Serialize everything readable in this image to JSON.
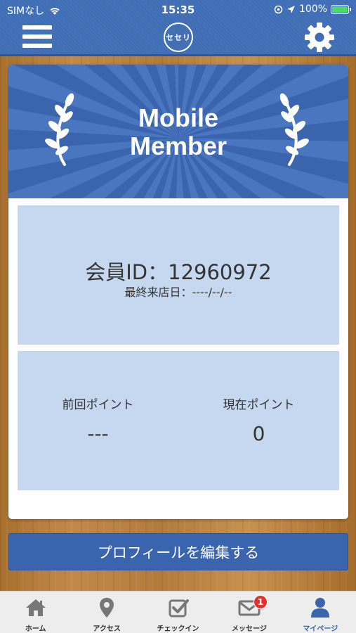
{
  "status_bar": {
    "carrier": "SIMなし",
    "time": "15:35",
    "battery": "100%"
  },
  "header": {
    "logo_text": "セセリ",
    "menu_icon": "hamburger-icon",
    "settings_icon": "gear-icon"
  },
  "banner": {
    "line1": "Mobile",
    "line2": "Member"
  },
  "member": {
    "id_text": "会員ID：12960972",
    "last_visit": "最終来店日：----/--/--"
  },
  "points": {
    "previous_label": "前回ポイント",
    "previous_value": "---",
    "current_label": "現在ポイント",
    "current_value": "0"
  },
  "profile_button": "プロフィールを編集する",
  "tabs": [
    {
      "label": "ホーム",
      "icon": "home-icon"
    },
    {
      "label": "アクセス",
      "icon": "map-pin-icon"
    },
    {
      "label": "チェックイン",
      "icon": "checkbox-icon"
    },
    {
      "label": "メッセージ",
      "icon": "mail-icon",
      "badge": "1"
    },
    {
      "label": "マイページ",
      "icon": "user-icon"
    }
  ],
  "colors": {
    "primary": "#3a64ad",
    "panel": "#c6d8f0",
    "badge": "#e2322e"
  }
}
